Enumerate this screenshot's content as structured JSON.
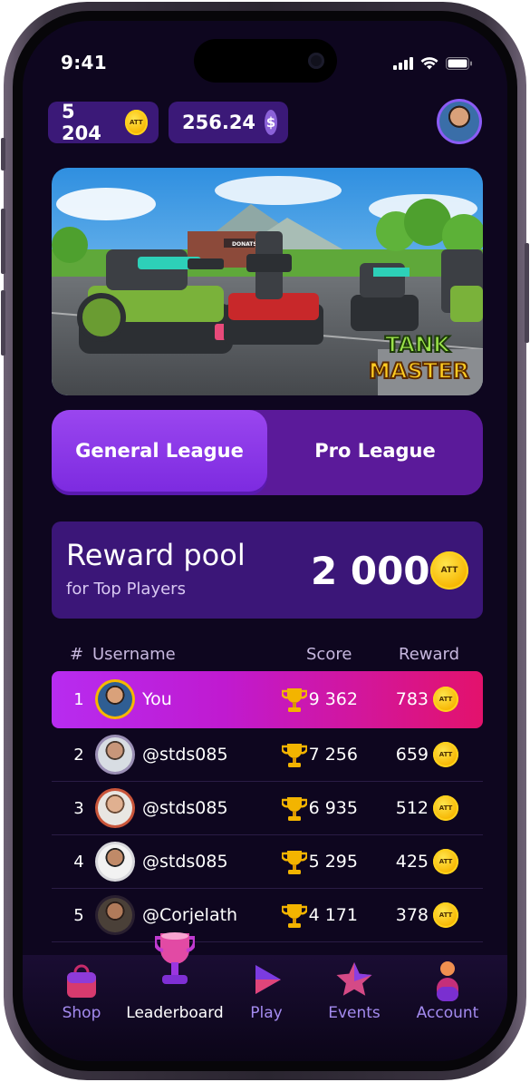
{
  "status_bar": {
    "time": "9:41"
  },
  "balances": {
    "att": "5 204",
    "usd": "256.24",
    "att_symbol": "ATT",
    "usd_symbol": "$"
  },
  "banner": {
    "game_title_line1": "TANK",
    "game_title_line2": "MASTER",
    "sign": "DONATS"
  },
  "league_tabs": [
    {
      "label": "General League",
      "active": true
    },
    {
      "label": "Pro League",
      "active": false
    }
  ],
  "reward_pool": {
    "title": "Reward pool",
    "subtitle": "for Top Players",
    "amount": "2 000",
    "currency": "ATT"
  },
  "table": {
    "headers": {
      "rank": "#",
      "username": "Username",
      "score": "Score",
      "reward": "Reward"
    },
    "rows": [
      {
        "rank": "1",
        "username": "You",
        "score": "9 362",
        "reward": "783",
        "highlight": true
      },
      {
        "rank": "2",
        "username": "@stds085",
        "score": "7 256",
        "reward": "659"
      },
      {
        "rank": "3",
        "username": "@stds085",
        "score": "6 935",
        "reward": "512"
      },
      {
        "rank": "4",
        "username": "@stds085",
        "score": "5 295",
        "reward": "425"
      },
      {
        "rank": "5",
        "username": "@Corjelath",
        "score": "4 171",
        "reward": "378"
      }
    ]
  },
  "bottom_nav": [
    {
      "label": "Shop",
      "icon": "shopping-bag-icon",
      "active": false
    },
    {
      "label": "Leaderboard",
      "icon": "trophy-icon",
      "active": true
    },
    {
      "label": "Play",
      "icon": "play-icon",
      "active": false
    },
    {
      "label": "Events",
      "icon": "star-icon",
      "active": false
    },
    {
      "label": "Account",
      "icon": "user-icon",
      "active": false
    }
  ],
  "colors": {
    "background": "#0e061f",
    "accent": "#8b3bec",
    "highlight_start": "#b72cf0",
    "highlight_end": "#e3126c",
    "coin": "#f6b500"
  }
}
